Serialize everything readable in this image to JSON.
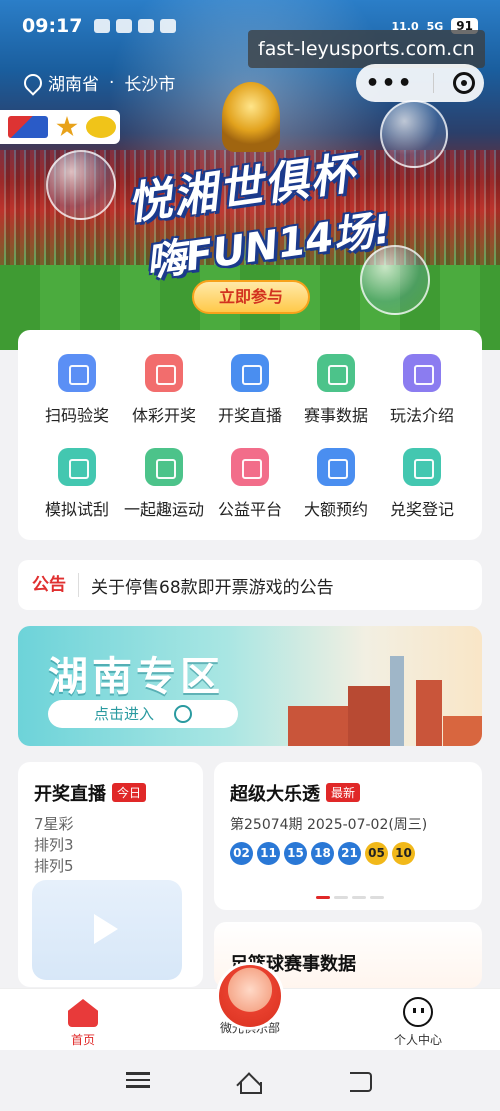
{
  "status_bar": {
    "time": "09:17",
    "network": "5G",
    "speed": "11.0",
    "battery": "91"
  },
  "url_badge": "fast-leyusports.com.cn",
  "location": {
    "province": "湖南省",
    "separator": "·",
    "city": "长沙市"
  },
  "hero": {
    "title_line1": "悦湘世俱杯",
    "title_line2": "嗨FUN14场!",
    "cta": "立即参与"
  },
  "services": [
    {
      "label": "扫码验奖",
      "icon": "scan-icon",
      "color": "#5b8ff5"
    },
    {
      "label": "体彩开奖",
      "icon": "lottery-ball-icon",
      "color": "#f26d6d"
    },
    {
      "label": "开奖直播",
      "icon": "live-video-icon",
      "color": "#4a8ef0"
    },
    {
      "label": "赛事数据",
      "icon": "chart-line-icon",
      "color": "#4cc38a"
    },
    {
      "label": "玩法介绍",
      "icon": "document-icon",
      "color": "#8b7cf0"
    },
    {
      "label": "模拟试刮",
      "icon": "scratch-card-icon",
      "color": "#43c7b0"
    },
    {
      "label": "一起趣运动",
      "icon": "sports-icon",
      "color": "#4cc38a"
    },
    {
      "label": "公益平台",
      "icon": "heart-pulse-icon",
      "color": "#f26d8a"
    },
    {
      "label": "大额预约",
      "icon": "yuan-calendar-icon",
      "color": "#4a8ef0"
    },
    {
      "label": "兑奖登记",
      "icon": "registration-icon",
      "color": "#43c7b0"
    }
  ],
  "notice": {
    "tag": "公告",
    "text": "关于停售68款即开票游戏的公告"
  },
  "hunan_banner": {
    "title": "湖南专区",
    "button": "点击进入"
  },
  "live_card": {
    "title": "开奖直播",
    "badge": "今日",
    "games": [
      "7星彩",
      "排列3",
      "排列5"
    ]
  },
  "lotto_card": {
    "title": "超级大乐透",
    "badge": "最新",
    "issue": "第25074期 2025-07-02(周三)",
    "front_numbers": [
      "02",
      "11",
      "15",
      "18",
      "21"
    ],
    "back_numbers": [
      "05",
      "10"
    ],
    "colors": {
      "front": "#2a78d6",
      "back": "#f1b81a"
    }
  },
  "sports_card": {
    "title": "足篮球赛事数据"
  },
  "tabbar": {
    "home": "首页",
    "club": "微光俱乐部",
    "me": "个人中心"
  },
  "accent_color": "#e02828"
}
